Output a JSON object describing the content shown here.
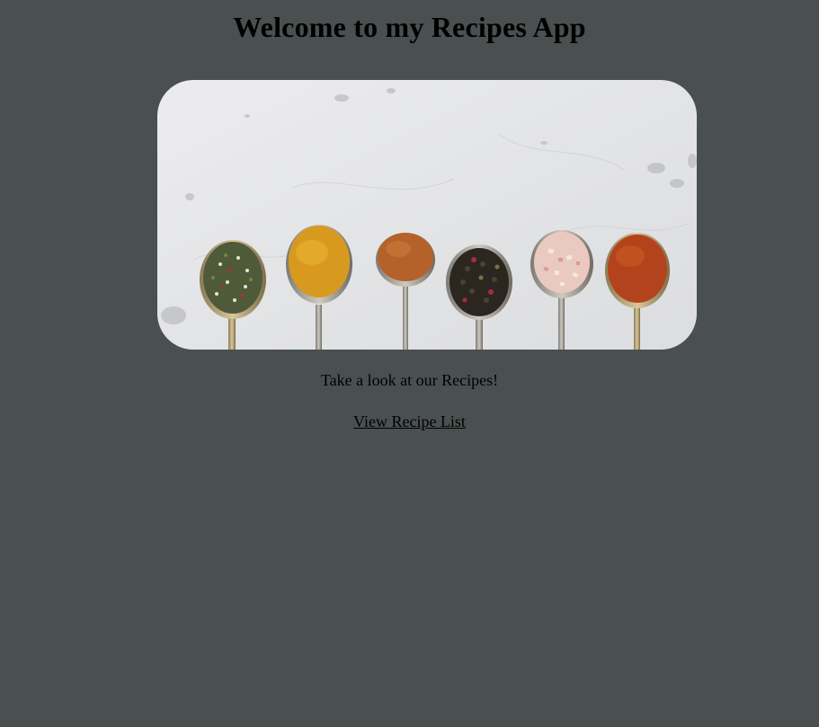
{
  "header": {
    "title": "Welcome to my Recipes App"
  },
  "hero": {
    "image_subject": "six spoons of spices on white marble"
  },
  "main": {
    "tagline": "Take a look at our Recipes!",
    "recipe_link_label": "View Recipe List"
  },
  "colors": {
    "background": "#4a5050",
    "text": "#000000"
  }
}
